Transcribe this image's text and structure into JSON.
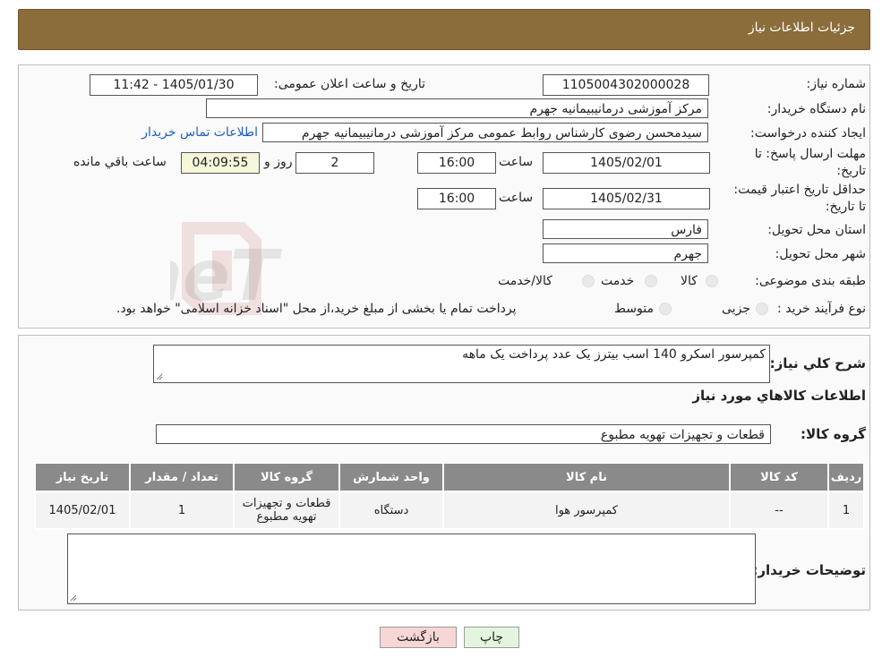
{
  "header": {
    "title": "جزئیات اطلاعات نیاز"
  },
  "need_info": {
    "need_number_label": "شماره نیاز:",
    "need_number": "1105004302000028",
    "announce_label": "تاریخ و ساعت اعلان عمومی:",
    "announce_value": "1405/01/30 - 11:42",
    "buyer_org_label": "نام دستگاه خریدار:",
    "buyer_org": "مرکز آموزشی درمانیبیمانیه جهرم",
    "requester_label": "ایجاد کننده درخواست:",
    "requester": "سیدمحسن رضوی کارشناس روابط عمومی مرکز آموزشی درمانیبیمانیه جهرم",
    "contact_link": "اطلاعات تماس خریدار",
    "reply_deadline_label": "مهلت ارسال پاسخ: تا تاریخ:",
    "reply_date": "1405/02/01",
    "hour_label": "ساعت",
    "reply_time": "16:00",
    "days_value": "2",
    "days_and_label": "روز و",
    "remaining_time": "04:09:55",
    "remaining_label": "ساعت باقي مانده",
    "price_validity_label": "حداقل تاریخ اعتبار قیمت: تا تاریخ:",
    "validity_date": "1405/02/31",
    "validity_hour_label": "ساعت",
    "validity_time": "16:00",
    "province_label": "استان محل تحویل:",
    "province": "فارس",
    "city_label": "شهر محل تحویل:",
    "city": "جهرم",
    "category_label": "طبقه بندی موضوعی:",
    "category_options": [
      "کالا",
      "خدمت",
      "کالا/خدمت"
    ],
    "process_label": "نوع فرآیند خرید :",
    "process_options": [
      "جزیی",
      "متوسط"
    ],
    "process_note": "پرداخت تمام یا بخشی از مبلغ خرید،از محل \"اسناد خزانه اسلامی\" خواهد بود."
  },
  "details": {
    "description_label": "شرح کلي نياز:",
    "description": "کمپرسور اسکرو 140 اسب بیترز یک عدد  پرداخت یک ماهه",
    "goods_info_title": "اطلاعات کالاهاي مورد نياز",
    "goods_group_label": "گروه کالا:",
    "goods_group": "قطعات و تجهیزات تهویه مطبوع",
    "table": {
      "headers": [
        "رديف",
        "کد کالا",
        "نام کالا",
        "واحد شمارش",
        "گروه کالا",
        "تعداد / مقدار",
        "تاریخ نیاز"
      ],
      "rows": [
        [
          "1",
          "--",
          "کمپرسور هوا",
          "دستگاه",
          "قطعات و تجهیزات تهویه مطبوع",
          "1",
          "1405/02/01"
        ]
      ]
    },
    "buyer_notes_label": "توضیحات خریدار:",
    "buyer_notes": ""
  },
  "buttons": {
    "print": "چاپ",
    "back": "بازگشت"
  },
  "colors": {
    "header": "#8a6d3b",
    "table_header": "#8a8a8a",
    "back_button": "#f7d6d6",
    "print_button": "#e3f6dd",
    "link": "#1d5fbf"
  }
}
